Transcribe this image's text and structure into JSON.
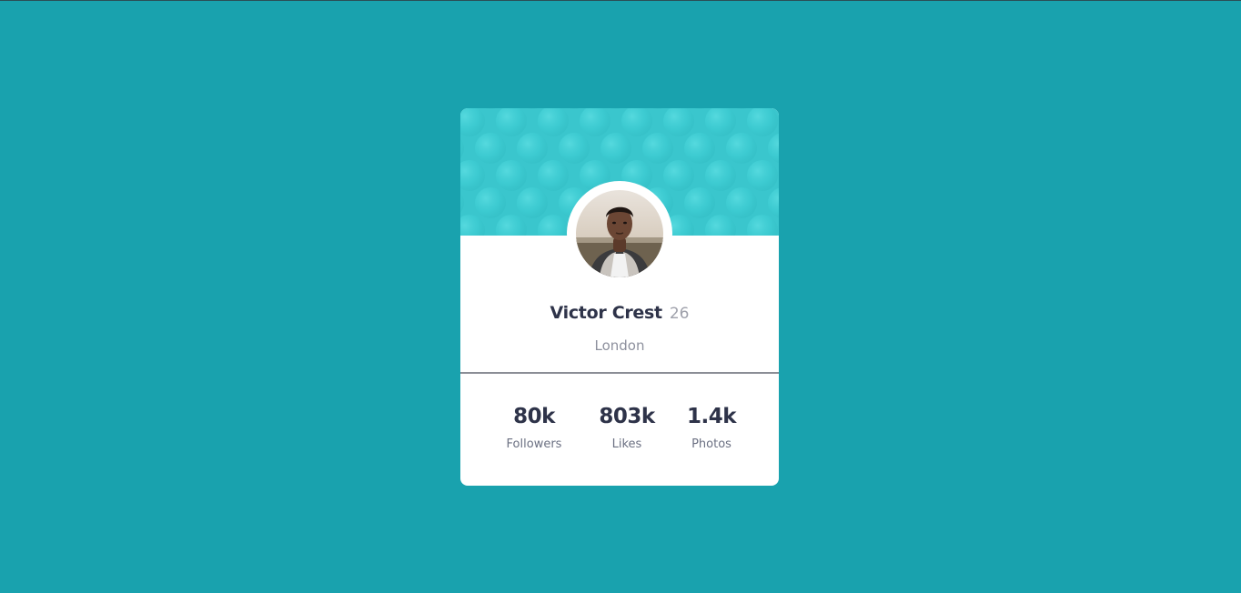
{
  "colors": {
    "page_background": "#19a2ae",
    "header_background": "#3ac6cd",
    "card_background": "#ffffff",
    "name_color": "#2e3349",
    "muted_text": "#8d909d"
  },
  "profile": {
    "name": "Victor Crest",
    "age": "26",
    "location": "London",
    "avatar_icon": "user-avatar-photo"
  },
  "stats": [
    {
      "value": "80k",
      "label": "Followers"
    },
    {
      "value": "803k",
      "label": "Likes"
    },
    {
      "value": "1.4k",
      "label": "Photos"
    }
  ]
}
